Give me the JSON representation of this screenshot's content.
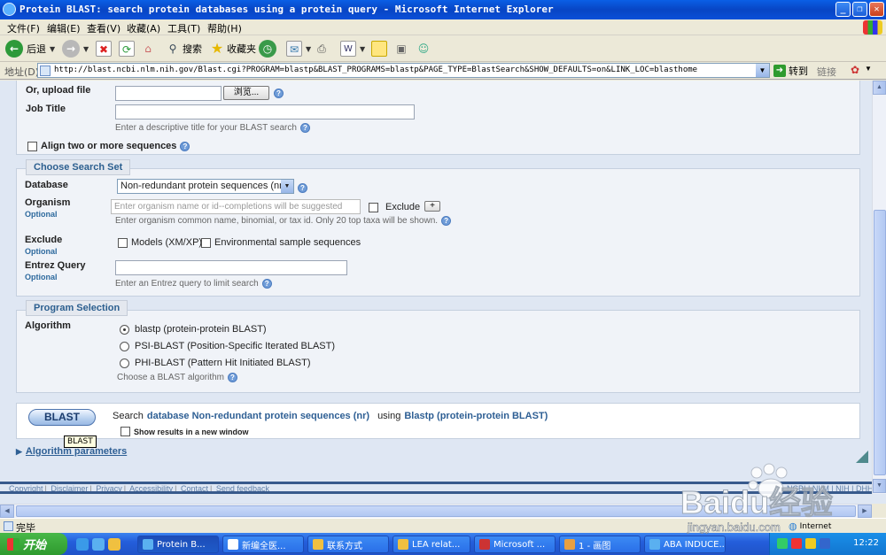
{
  "window": {
    "title": "Protein BLAST: search protein databases using a protein query - Microsoft Internet Explorer"
  },
  "menu": [
    "文件(F)",
    "编辑(E)",
    "查看(V)",
    "收藏(A)",
    "工具(T)",
    "帮助(H)"
  ],
  "toolbar": {
    "back_label": "后退",
    "search_label": "搜索",
    "favorites_label": "收藏夹"
  },
  "address": {
    "label": "地址(D)",
    "url": "http://blast.ncbi.nlm.nih.gov/Blast.cgi?PROGRAM=blastp&BLAST_PROGRAMS=blastp&PAGE_TYPE=BlastSearch&SHOW_DEFAULTS=on&LINK_LOC=blasthome",
    "go_label": "转到",
    "links_label": "链接"
  },
  "form": {
    "upload_label": "Or, upload file",
    "browse_label": "浏览...",
    "job_title_label": "Job Title",
    "job_title_hint": "Enter a descriptive title for your BLAST search",
    "align_label": "Align two or more sequences"
  },
  "search_set": {
    "legend": "Choose Search Set",
    "database_label": "Database",
    "database_value": "Non-redundant protein sequences (nr)",
    "organism_label": "Organism",
    "optional": "Optional",
    "organism_placeholder": "Enter organism name or id--completions will be suggested",
    "exclude_check_label": "Exclude",
    "plus_label": "+",
    "organism_hint": "Enter organism common name, binomial, or tax id. Only 20 top taxa will be shown.",
    "exclude_label": "Exclude",
    "models_label": "Models (XM/XP)",
    "env_label": "Environmental sample sequences",
    "entrez_label": "Entrez Query",
    "entrez_hint": "Enter an Entrez query to limit search"
  },
  "program": {
    "legend": "Program Selection",
    "algorithm_label": "Algorithm",
    "options": [
      "blastp (protein-protein BLAST)",
      "PSI-BLAST (Position-Specific Iterated BLAST)",
      "PHI-BLAST (Pattern Hit Initiated BLAST)"
    ],
    "selected_index": 0,
    "hint": "Choose a BLAST algorithm"
  },
  "submit": {
    "button_label": "BLAST",
    "tooltip": "BLAST",
    "search_word": "Search",
    "database_phrase": "database Non-redundant protein sequences (nr)",
    "using_word": "using",
    "program_phrase": "Blastp (protein-protein BLAST)",
    "new_window_label": "Show results in a new window"
  },
  "algorithm_params_label": "Algorithm parameters",
  "footer": {
    "links": [
      "Copyright",
      "Disclaimer",
      "Privacy",
      "Accessibility",
      "Contact",
      "Send feedback"
    ],
    "right_links": "NCBI | NLM | NIH | DHHS"
  },
  "status": {
    "text": "完毕",
    "zone": "Internet"
  },
  "taskbar": {
    "start_label": "开始",
    "tasks": [
      "Protein B...",
      "新编全医...",
      "联系方式",
      "LEA relat...",
      "Microsoft ...",
      "1 - 画图",
      "ABA INDUCE..."
    ],
    "clock": "12:22"
  },
  "watermark": {
    "text": "Baidu经验",
    "url": "jingyan.baidu.com"
  },
  "colors": {
    "accent": "#2e5f94",
    "panel_bg": "#dfe7f3",
    "titlebar": "#0a5fe6"
  }
}
